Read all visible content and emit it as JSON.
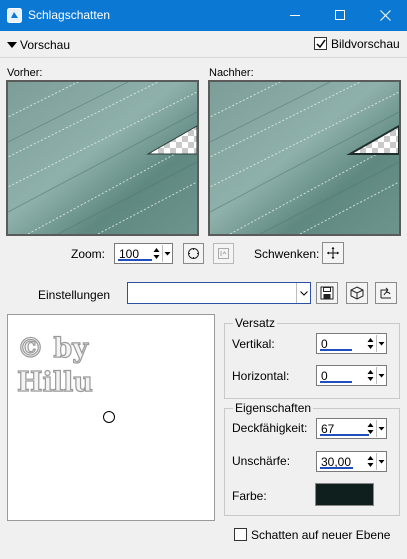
{
  "window": {
    "title": "Schlagschatten"
  },
  "preview": {
    "section_label": "Vorschau",
    "show_preview_label": "Bildvorschau",
    "show_preview_checked": true,
    "before_label": "Vorher:",
    "after_label": "Nachher:",
    "zoom_label": "Zoom:",
    "zoom_value": "100",
    "pan_label": "Schwenken:"
  },
  "settings": {
    "label": "Einstellungen",
    "selected_preset": ""
  },
  "watermark": "© by Hillu",
  "offset": {
    "group_label": "Versatz",
    "vertical_label": "Vertikal:",
    "vertical_value": "0",
    "horizontal_label": "Horizontal:",
    "horizontal_value": "0"
  },
  "properties": {
    "group_label": "Eigenschaften",
    "opacity_label": "Deckfähigkeit:",
    "opacity_value": "67",
    "blur_label": "Unschärfe:",
    "blur_value": "30,00",
    "color_label": "Farbe:",
    "color_value": "#0f1f1d"
  },
  "shadow_new_layer": {
    "label": "Schatten auf neuer Ebene",
    "checked": false
  },
  "colors": {
    "titlebar": "#0b78d4",
    "accent_underline": "#1f4fbf",
    "preview_teal": "#6b938c"
  }
}
